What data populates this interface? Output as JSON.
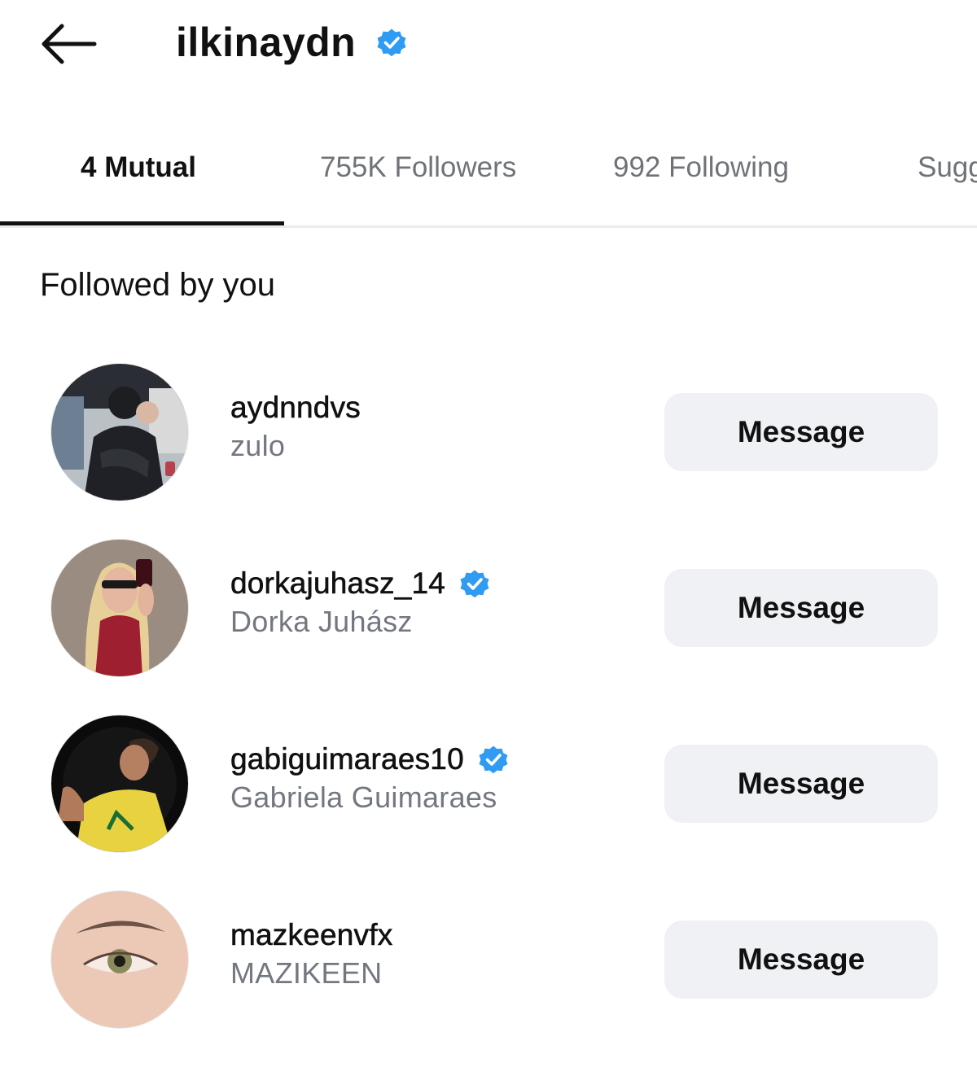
{
  "header": {
    "title": "ilkinaydn",
    "back_icon": "arrow-left-icon",
    "verified_icon": "verified-badge-icon",
    "verified_color": "#2f9bf2"
  },
  "tabs": [
    {
      "label": "4 Mutual",
      "active": true
    },
    {
      "label": "755K Followers",
      "active": false
    },
    {
      "label": "992 Following",
      "active": false
    },
    {
      "label": "Sugg",
      "active": false
    }
  ],
  "section": {
    "heading": "Followed by you"
  },
  "users": [
    {
      "username": "aydnndvs",
      "full_name": "zulo",
      "verified": false,
      "button": "Message"
    },
    {
      "username": "dorkajuhasz_14",
      "full_name": "Dorka Juhász",
      "verified": true,
      "button": "Message"
    },
    {
      "username": "gabiguimaraes10",
      "full_name": "Gabriela Guimaraes",
      "verified": true,
      "button": "Message"
    },
    {
      "username": "mazkeenvfx",
      "full_name": "MAZIKEEN",
      "verified": false,
      "button": "Message"
    }
  ],
  "colors": {
    "accent_blue": "#2f9bf2",
    "button_bg": "#eff1f4",
    "secondary_text": "#737880"
  }
}
